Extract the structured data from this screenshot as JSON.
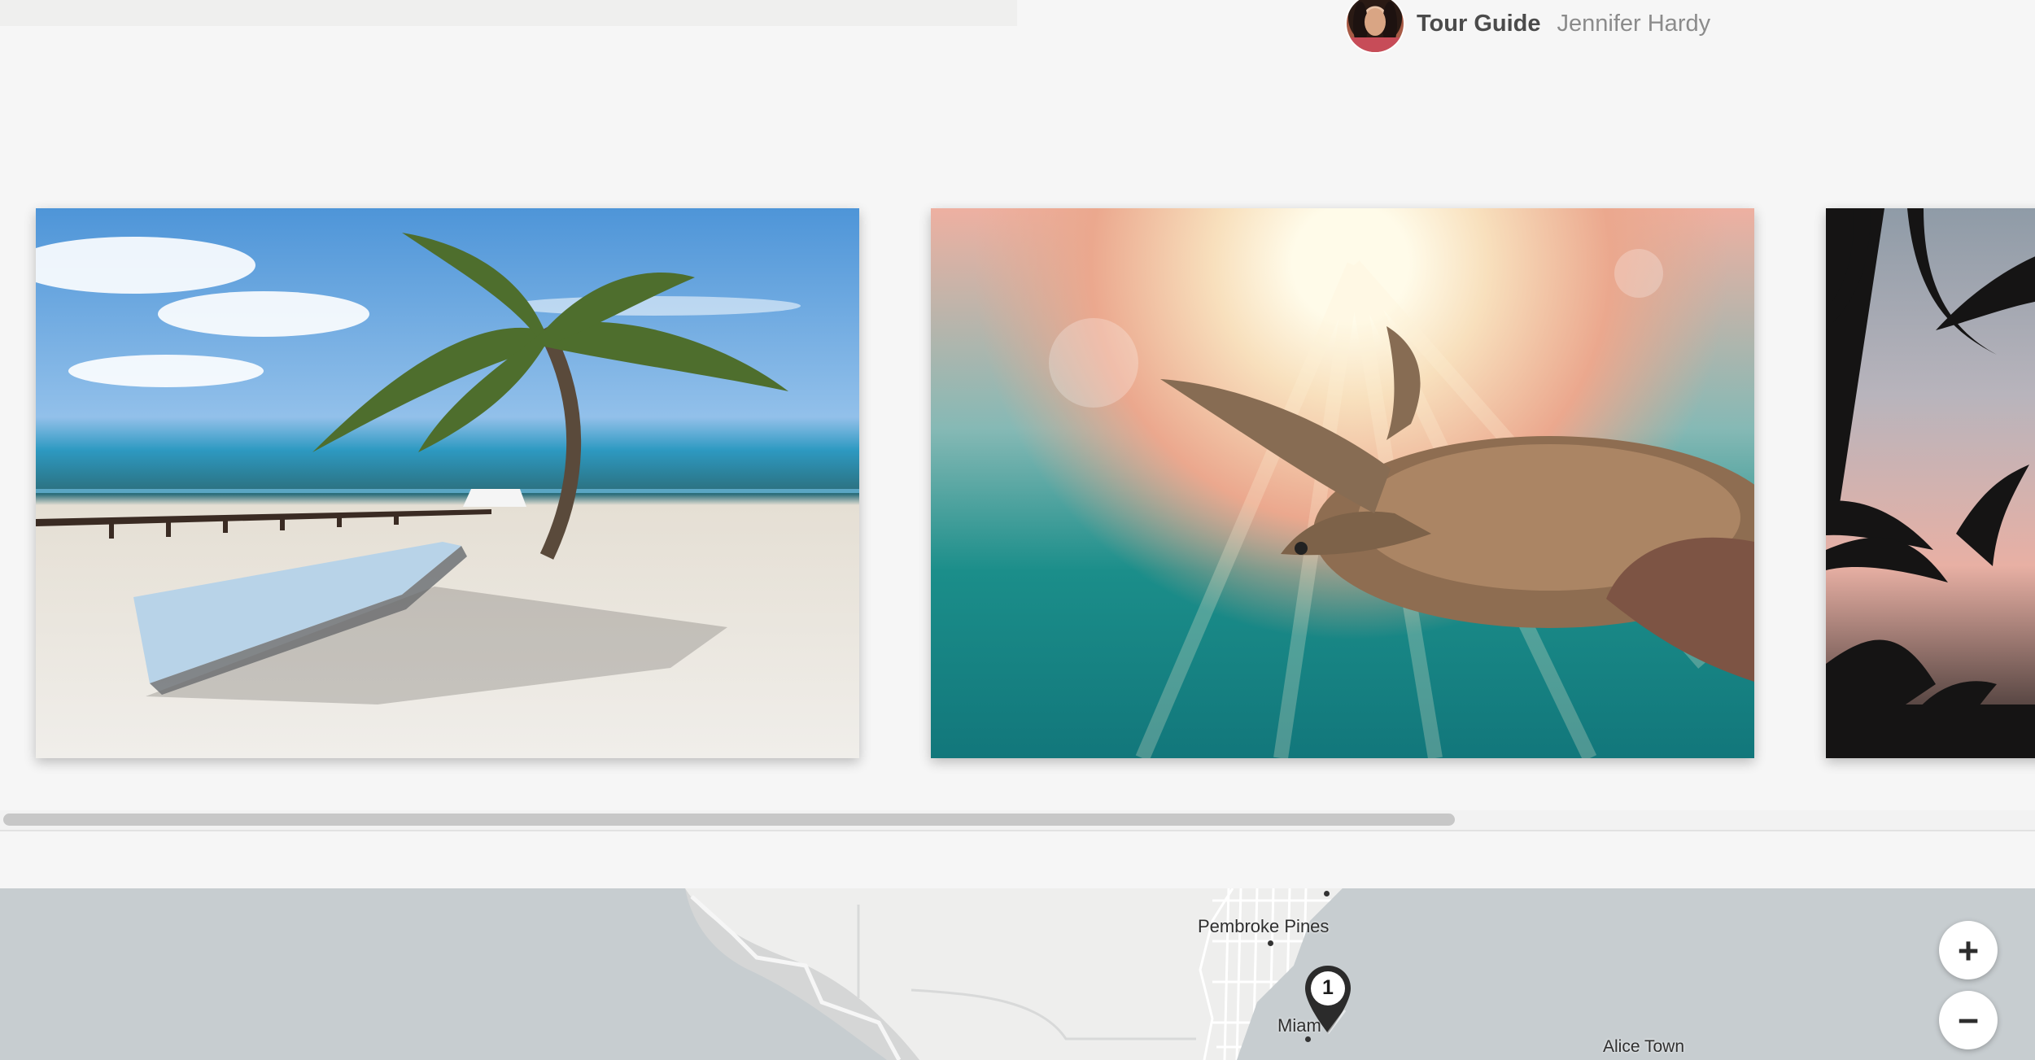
{
  "header": {
    "guide_role": "Tour Guide",
    "guide_name": "Jennifer Hardy",
    "avatar_icon": "person-avatar"
  },
  "gallery": {
    "images": [
      {
        "name": "beach-palm-tree-photo",
        "description": "beach with palm tree, dock and white boat"
      },
      {
        "name": "sea-turtle-photo",
        "description": "sea turtle swimming underwater toward the sun"
      },
      {
        "name": "palm-trees-sunset-photo",
        "description": "silhouetted palm trees at sunset"
      }
    ],
    "scroll_position": 0
  },
  "map": {
    "labels": {
      "pembroke_pines": "Pembroke Pines",
      "miami": "Miam",
      "alice_town": "Alice Town"
    },
    "marker_number": "1",
    "zoom_in": "+",
    "zoom_out": "−",
    "colors": {
      "water": "#c7cdd0",
      "land": "#eeeeed",
      "roads": "#ffffff",
      "marker": "#2b2b2b"
    }
  }
}
